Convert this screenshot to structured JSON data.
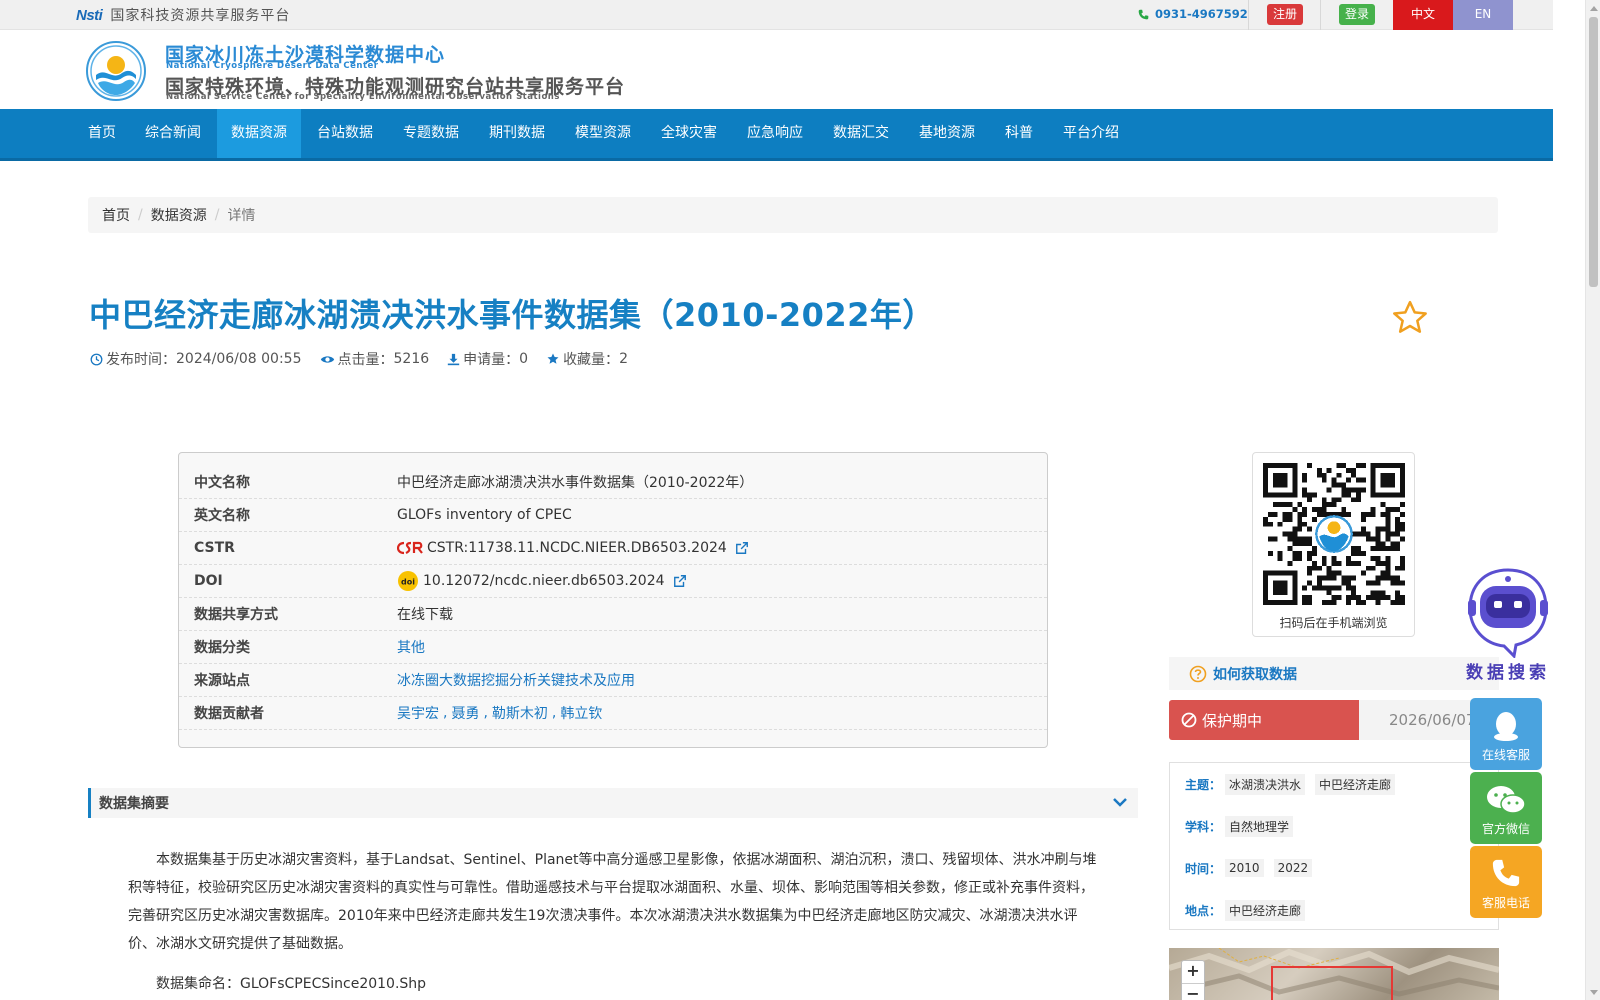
{
  "topbar": {
    "platform_name": "国家科技资源共享服务平台",
    "logo_mark": "Nsti",
    "phone": "0931-4967592",
    "register_label": "注册",
    "login_label": "登录",
    "lang_zh": "中文",
    "lang_en": "EN"
  },
  "header": {
    "title_cn": "国家冰川冻土沙漠科学数据中心",
    "title_en": "National Cryosphere Desert Data Center",
    "subtitle_cn": "国家特殊环境、特殊功能观测研究台站共享服务平台",
    "subtitle_en": "National Service Center for Speciality Environmental Observation Stations"
  },
  "nav": {
    "items": [
      {
        "label": "首页"
      },
      {
        "label": "综合新闻"
      },
      {
        "label": "数据资源"
      },
      {
        "label": "台站数据"
      },
      {
        "label": "专题数据"
      },
      {
        "label": "期刊数据"
      },
      {
        "label": "模型资源"
      },
      {
        "label": "全球灾害"
      },
      {
        "label": "应急响应"
      },
      {
        "label": "数据汇交"
      },
      {
        "label": "基地资源"
      },
      {
        "label": "科普"
      },
      {
        "label": "平台介绍"
      }
    ],
    "active_index": 2
  },
  "breadcrumb": {
    "home": "首页",
    "level1": "数据资源",
    "current": "详情"
  },
  "dataset": {
    "title": "中巴经济走廊冰湖溃决洪水事件数据集（2010-2022年）",
    "publish_label": "发布时间：",
    "publish_time": "2024/06/08 00:55",
    "views_label": "点击量：",
    "views": "5216",
    "requests_label": "申请量：",
    "requests": "0",
    "favorites_label": "收藏量：",
    "favorites": "2"
  },
  "info": {
    "rows": [
      {
        "key": "中文名称",
        "value": "中巴经济走廊冰湖溃决洪水事件数据集（2010-2022年）"
      },
      {
        "key": "英文名称",
        "value": "GLOFs inventory of CPEC"
      },
      {
        "key": "CSTR",
        "value": "CSTR:11738.11.NCDC.NIEER.DB6503.2024"
      },
      {
        "key": "DOI",
        "value": "10.12072/ncdc.nieer.db6503.2024"
      },
      {
        "key": "数据共享方式",
        "value": "在线下载"
      },
      {
        "key": "数据分类",
        "value": "其他"
      },
      {
        "key": "来源站点",
        "value": "冰冻圈大数据挖掘分析关键技术及应用"
      },
      {
        "key": "数据贡献者",
        "value": ""
      }
    ],
    "contributors": [
      "吴宇宏",
      "聂勇",
      "勒斯木初",
      "韩立钦"
    ],
    "contributor_sep": ","
  },
  "sidebar": {
    "qr_caption": "扫码后在手机端浏览",
    "howto_label": "如何获取数据",
    "protect_label": "保护期中",
    "protect_date": "2026/06/07",
    "topic_label": "主题：",
    "topics": [
      "冰湖溃决洪水",
      "中巴经济走廊"
    ],
    "discipline_label": "学科：",
    "disciplines": [
      "自然地理学"
    ],
    "time_label": "时间：",
    "times": [
      "2010",
      "2022"
    ],
    "place_label": "地点：",
    "places": [
      "中巴经济走廊"
    ],
    "zoom_in": "+",
    "zoom_out": "−"
  },
  "abstract": {
    "heading": "数据集摘要",
    "text": "本数据集基于历史冰湖灾害资料，基于Landsat、Sentinel、Planet等中高分遥感卫星影像，依据冰湖面积、湖泊沉积，溃口、残留坝体、洪水冲刷与堆积等特征，校验研究区历史冰湖灾害资料的真实性与可靠性。借助遥感技术与平台提取冰湖面积、水量、坝体、影响范围等相关参数，修正或补充事件资料，完善研究区历史冰湖灾害数据库。2010年来中巴经济走廊共发生19次溃决事件。本次冰湖溃决洪水数据集为中巴经济走廊地区防灾减灾、冰湖溃决洪水评价、冰湖水文研究提供了基础数据。",
    "filename_line": "数据集命名：GLOFsCPECSince2010.Shp"
  },
  "floating": {
    "robot_label": "数据搜索",
    "qq_label": "在线客服",
    "wechat_label": "官方微信",
    "phone_label": "客服电话"
  },
  "colors": {
    "nav_bg": "#0d7ec1",
    "nav_active": "#1c9bdf",
    "title": "#1680c3",
    "register": "#d9393a",
    "login": "#46b14b",
    "protect": "#d9534f"
  }
}
